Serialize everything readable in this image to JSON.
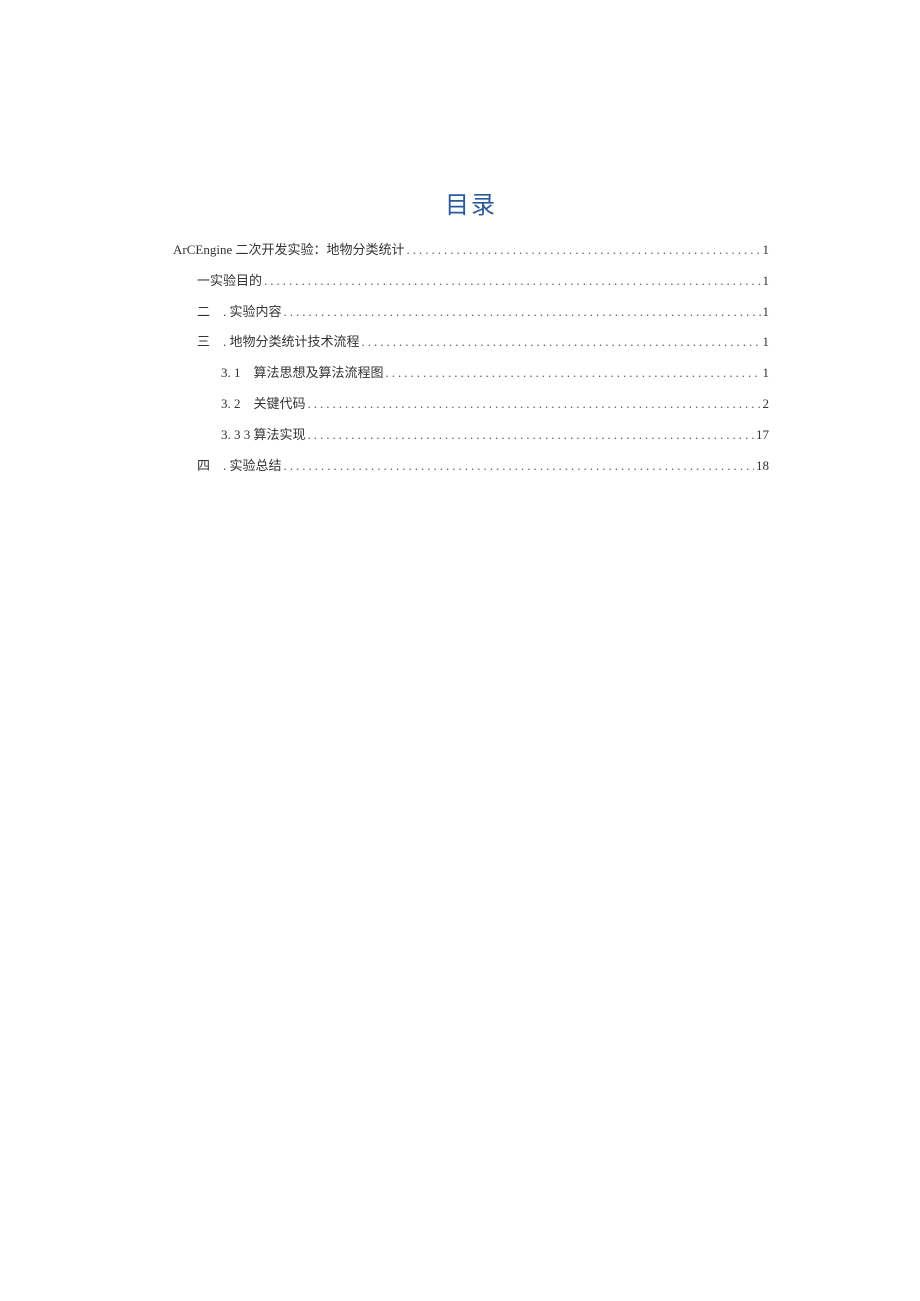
{
  "title": "目录",
  "toc": [
    {
      "level": 0,
      "label": "ArCEngine 二次开发实验：地物分类统计",
      "page": "1"
    },
    {
      "level": 1,
      "label": "一实验目的",
      "page": "1"
    },
    {
      "level": 1,
      "label": "二　. 实验内容",
      "page": "1"
    },
    {
      "level": 1,
      "label": "三　. 地物分类统计技术流程",
      "page": "1"
    },
    {
      "level": 2,
      "label": "3. 1　算法思想及算法流程图",
      "page": "1"
    },
    {
      "level": 2,
      "label": "3. 2　关键代码",
      "page": "2"
    },
    {
      "level": 2,
      "label": "3. 3 3 算法实现",
      "page": "17"
    },
    {
      "level": 1,
      "label": "四　. 实验总结",
      "page": "18"
    }
  ]
}
